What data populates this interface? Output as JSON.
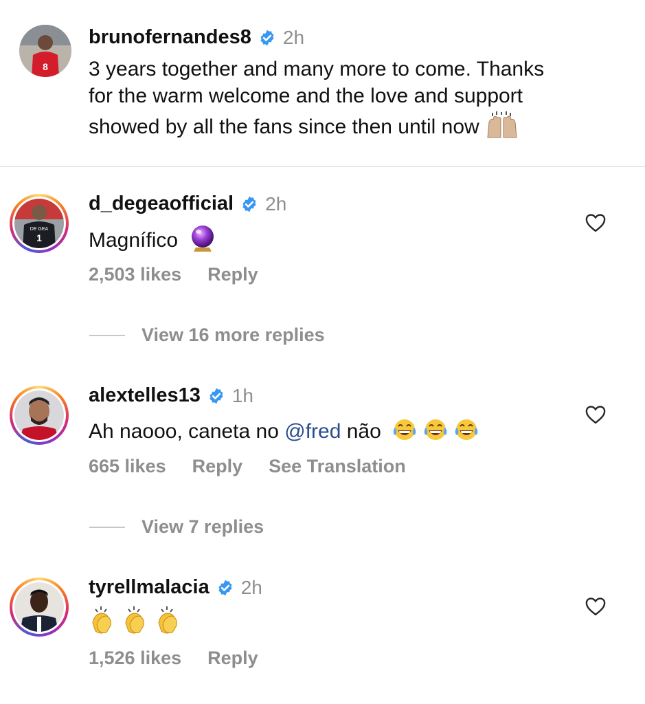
{
  "post": {
    "username": "brunofernandes8",
    "time": "2h",
    "caption_lines": [
      "3 years together and many more to come. Thanks",
      "for the warm welcome and the love and support",
      "showed by all the fans since then until now"
    ],
    "avatar_number": "8"
  },
  "comments": [
    {
      "username": "d_degeaofficial",
      "time": "2h",
      "text": "Magnífico",
      "likes": "2,503 likes",
      "reply_label": "Reply",
      "view_replies": "View 16 more replies",
      "jersey": "DE GEA",
      "jersey_number": "1"
    },
    {
      "username": "alextelles13",
      "time": "1h",
      "text_before": "Ah naooo, caneta no ",
      "mention": "@fred",
      "text_after": " não",
      "likes": "665 likes",
      "reply_label": "Reply",
      "translate_label": "See Translation",
      "view_replies": "View 7 replies"
    },
    {
      "username": "tyrellmalacia",
      "time": "2h",
      "likes": "1,526 likes",
      "reply_label": "Reply"
    }
  ],
  "colors": {
    "verified": "#3897f0",
    "meta_gray": "#8e8e8e",
    "mention": "#2a4d8f"
  }
}
